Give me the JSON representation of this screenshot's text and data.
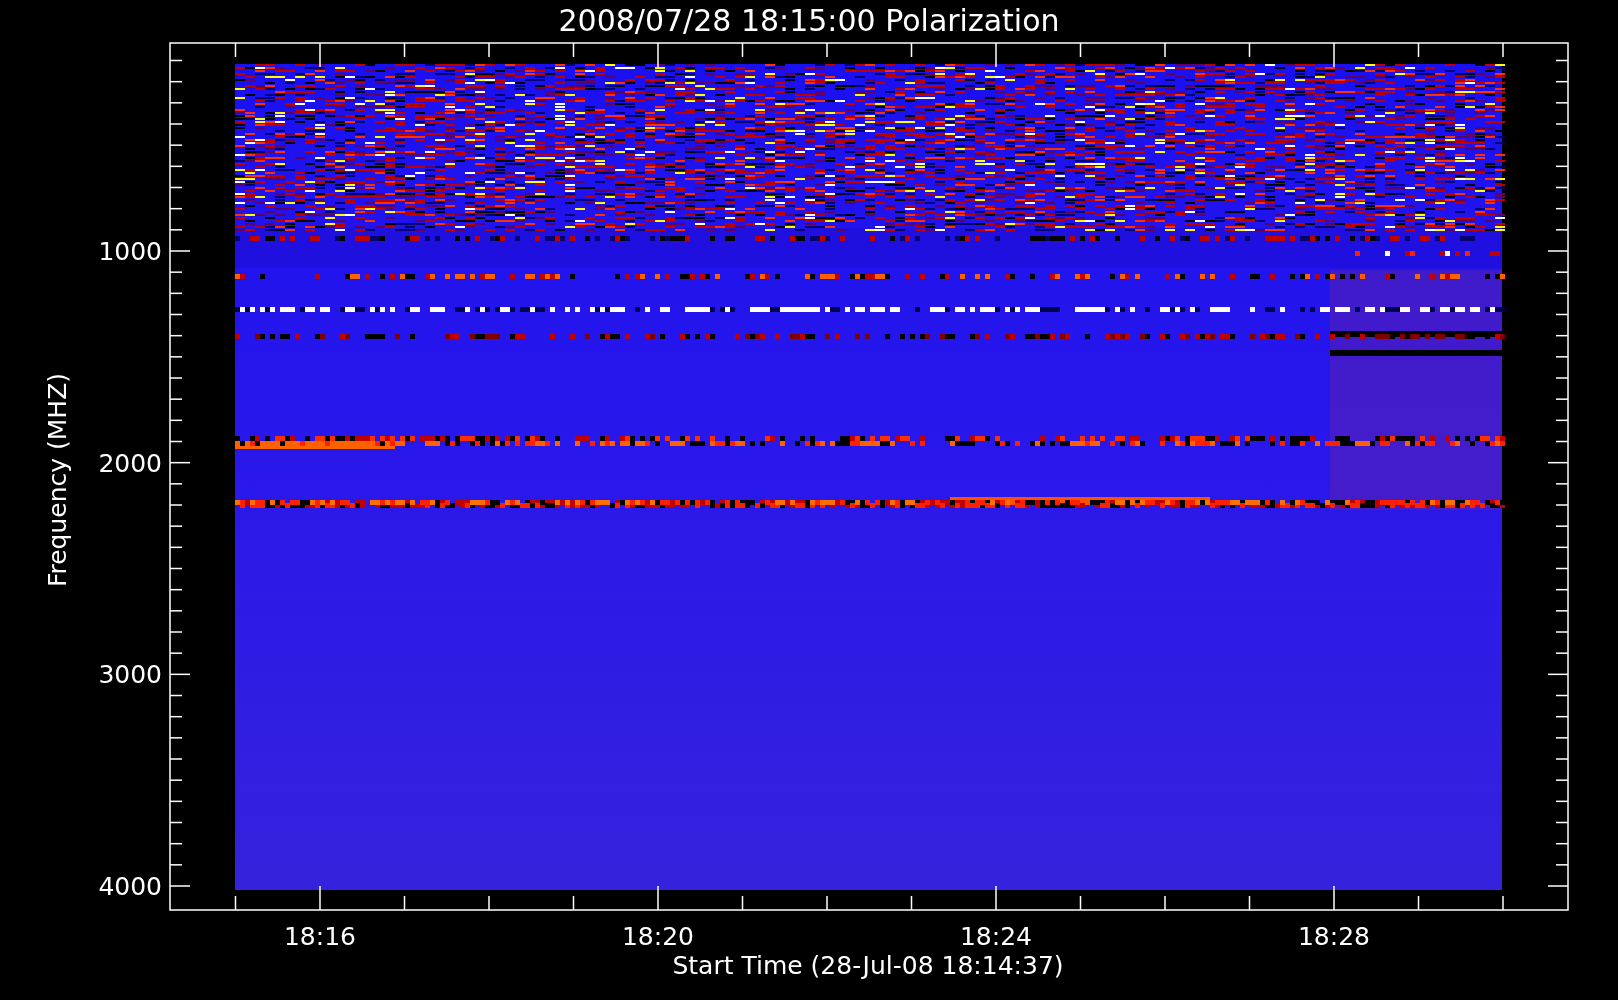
{
  "plot": {
    "title": "2008/07/28 18:15:00 Polarization",
    "y_axis": {
      "label": "Frequency (MHZ)",
      "ticks": [
        "1000",
        "2000",
        "3000",
        "4000"
      ]
    },
    "x_axis": {
      "label": "Start Time (28-Jul-08 18:14:37)",
      "ticks": [
        "18:16",
        "18:20",
        "18:24",
        "18:28"
      ]
    }
  }
}
